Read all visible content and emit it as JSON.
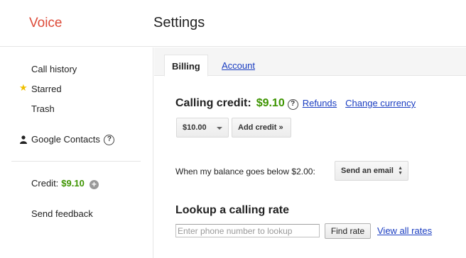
{
  "header": {
    "logo": "Voice",
    "title": "Settings"
  },
  "sidebar": {
    "items": [
      {
        "label": "Call history"
      },
      {
        "label": "Starred"
      },
      {
        "label": "Trash"
      }
    ],
    "contacts_label": "Google Contacts",
    "help_glyph": "?",
    "credit_label": "Credit:",
    "credit_amount": "$9.10",
    "plus_glyph": "+",
    "feedback_label": "Send feedback"
  },
  "tabs": [
    {
      "label": "Billing",
      "active": true
    },
    {
      "label": "Account",
      "active": false
    }
  ],
  "billing": {
    "credit_label": "Calling credit:",
    "credit_value": "$9.10",
    "help_glyph": "?",
    "refunds_link": "Refunds",
    "currency_link": "Change currency",
    "amount_selected": "$10.00",
    "add_credit_label": "Add credit »",
    "threshold_label": "When my balance goes below $2.00:",
    "threshold_action": "Send an email",
    "lookup_heading": "Lookup a calling rate",
    "lookup_placeholder": "Enter phone number to lookup",
    "find_rate_label": "Find rate",
    "all_rates_link": "View all rates"
  },
  "colors": {
    "brand_red": "#dd4b39",
    "credit_green": "#3d9400",
    "link_blue": "#1a3dc1",
    "star_yellow": "#f0c000"
  },
  "icons": [
    "star-icon",
    "person-icon",
    "help-icon",
    "plus-circle-icon",
    "chevron-down-icon",
    "up-down-icon"
  ]
}
